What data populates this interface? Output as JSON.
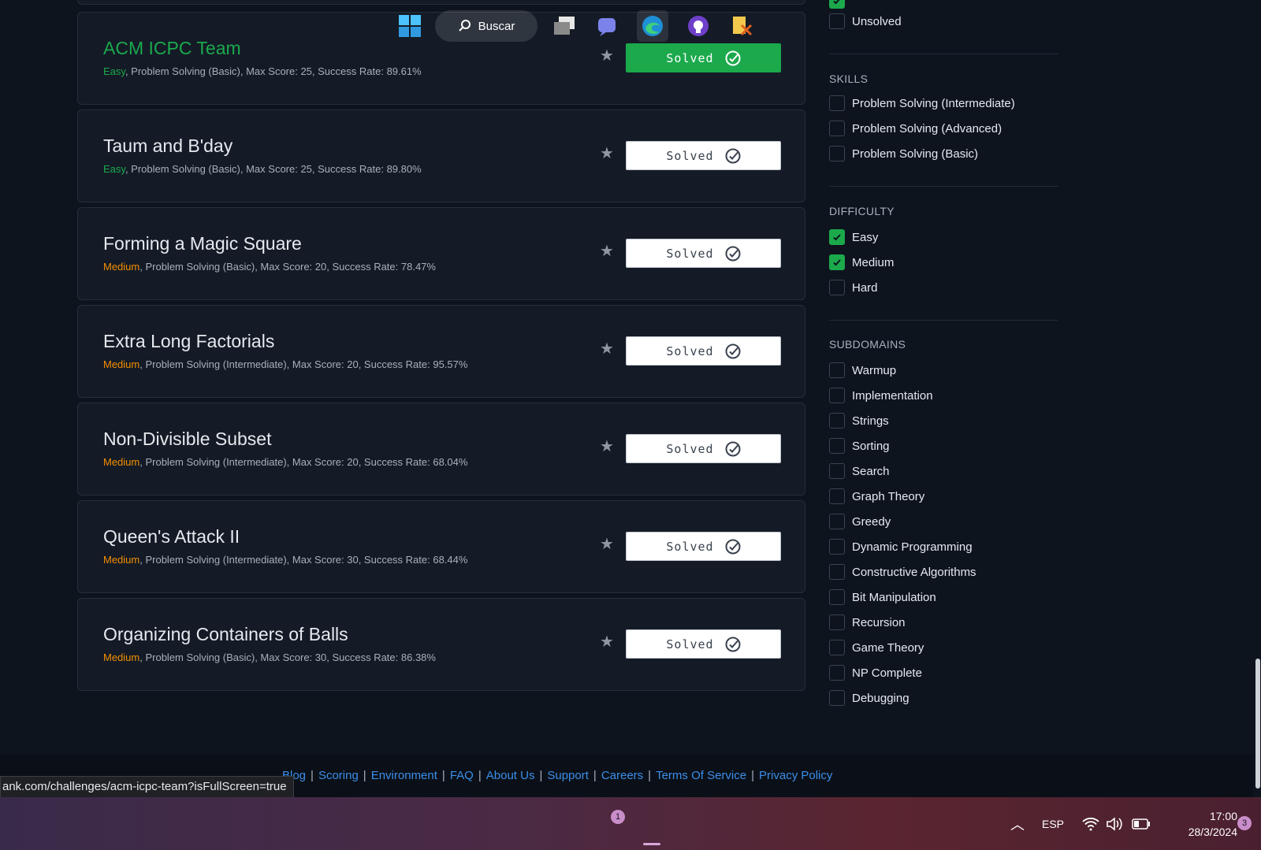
{
  "challenges": [
    {
      "title": "ACM ICPC Team",
      "difficulty": "Easy",
      "details": ", Problem Solving (Basic), Max Score: 25, Success Rate: 89.61%",
      "button": "Solved"
    },
    {
      "title": "Taum and B'day",
      "difficulty": "Easy",
      "details": ", Problem Solving (Basic), Max Score: 25, Success Rate: 89.80%",
      "button": "Solved"
    },
    {
      "title": "Forming a Magic Square",
      "difficulty": "Medium",
      "details": ", Problem Solving (Basic), Max Score: 20, Success Rate: 78.47%",
      "button": "Solved"
    },
    {
      "title": "Extra Long Factorials",
      "difficulty": "Medium",
      "details": ", Problem Solving (Intermediate), Max Score: 20, Success Rate: 95.57%",
      "button": "Solved"
    },
    {
      "title": "Non-Divisible Subset",
      "difficulty": "Medium",
      "details": ", Problem Solving (Intermediate), Max Score: 20, Success Rate: 68.04%",
      "button": "Solved"
    },
    {
      "title": "Queen's Attack II",
      "difficulty": "Medium",
      "details": ", Problem Solving (Intermediate), Max Score: 30, Success Rate: 68.44%",
      "button": "Solved"
    },
    {
      "title": "Organizing Containers of Balls",
      "difficulty": "Medium",
      "details": ", Problem Solving (Basic), Max Score: 30, Success Rate: 86.38%",
      "button": "Solved"
    }
  ],
  "filters": {
    "status": {
      "unsolved": "Unsolved"
    },
    "skills": {
      "title": "SKILLS",
      "options": [
        "Problem Solving (Intermediate)",
        "Problem Solving (Advanced)",
        "Problem Solving (Basic)"
      ]
    },
    "difficulty": {
      "title": "DIFFICULTY",
      "options": [
        "Easy",
        "Medium",
        "Hard"
      ]
    },
    "subdomains": {
      "title": "SUBDOMAINS",
      "options": [
        "Warmup",
        "Implementation",
        "Strings",
        "Sorting",
        "Search",
        "Graph Theory",
        "Greedy",
        "Dynamic Programming",
        "Constructive Algorithms",
        "Bit Manipulation",
        "Recursion",
        "Game Theory",
        "NP Complete",
        "Debugging"
      ]
    }
  },
  "footer": {
    "links": [
      "Blog",
      "Scoring",
      "Environment",
      "FAQ",
      "About Us",
      "Support",
      "Careers",
      "Terms Of Service",
      "Privacy Policy"
    ]
  },
  "status_url": "ank.com/challenges/acm-icpc-team?isFullScreen=true",
  "taskbar": {
    "search_label": "Buscar",
    "language": "ESP",
    "time": "17:00",
    "date": "28/3/2024",
    "chat_badge": "1",
    "notification_badge": "3"
  },
  "colors": {
    "accent_green": "#1ba94c",
    "medium_orange": "#f58e00",
    "link_blue": "#3b8ee8",
    "background": "#0e141e"
  }
}
